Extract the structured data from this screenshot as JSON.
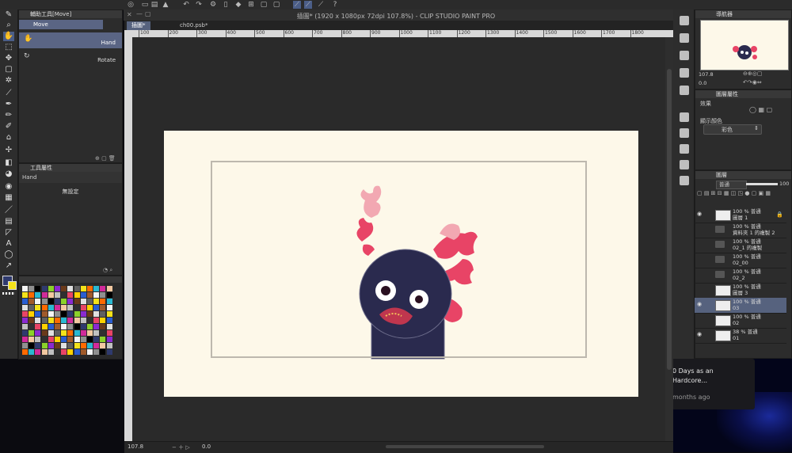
{
  "window": {
    "title": "插圖* (1920 x 1080px 72dpi 107.8%) - CLIP STUDIO PAINT PRO",
    "tabs": [
      "插圖*",
      "ch00.psb*"
    ]
  },
  "sub_tool": {
    "header": "輔助工具[Move]",
    "tab_label": "Move",
    "items": [
      {
        "label": "Hand",
        "selected": true
      },
      {
        "label": "Rotate",
        "selected": false
      }
    ]
  },
  "tool_property": {
    "header": "工具屬性",
    "tool_name": "Hand",
    "preset_label": "無設定"
  },
  "navigator": {
    "header": "導航器",
    "zoom": "107.8",
    "angle": "0.0"
  },
  "layer_property": {
    "header": "圖層屬性",
    "effect_label": "效果",
    "display_color_label": "顯示顏色",
    "color_value": "彩色"
  },
  "layer_panel": {
    "header": "圖層",
    "blend_mode": "普通",
    "opacity": "100",
    "layers": [
      {
        "line1": "100 % 普通",
        "line2": "圖層 1",
        "type": "layer",
        "visible": true,
        "locked": true
      },
      {
        "line1": "100 % 普通",
        "line2": "資料夾 1 的複製 2",
        "type": "folder",
        "visible": false
      },
      {
        "line1": "100 % 普通",
        "line2": "02_1 的複製",
        "type": "folder",
        "visible": false
      },
      {
        "line1": "100 % 普通",
        "line2": "02_00",
        "type": "folder",
        "visible": false
      },
      {
        "line1": "100 % 普通",
        "line2": "02_2",
        "type": "folder",
        "visible": false
      },
      {
        "line1": "100 % 普通",
        "line2": "圖層 3",
        "type": "layer",
        "visible": false
      },
      {
        "line1": "100 % 普通",
        "line2": "03",
        "type": "layer",
        "visible": true,
        "selected": true
      },
      {
        "line1": "100 % 普通",
        "line2": "02",
        "type": "layer",
        "visible": false
      },
      {
        "line1": "38 % 普通",
        "line2": "01",
        "type": "layer",
        "visible": true
      }
    ]
  },
  "ruler_ticks": [
    "100",
    "200",
    "300",
    "400",
    "500",
    "600",
    "700",
    "800",
    "900",
    "1000",
    "1100",
    "1200",
    "1300",
    "1400",
    "1500",
    "1600",
    "1700",
    "1800"
  ],
  "status": {
    "zoom": "107.8",
    "angle": "0.0"
  },
  "notification": {
    "line1": "0 Days as an",
    "line2": "Hardcore...",
    "line3": "months ago"
  },
  "colors": {
    "main": "#2f3a6e",
    "sub": "#f4e21a",
    "character_body": "#2a2a4e",
    "gills": "#e84466",
    "paper": "#fdf8e9"
  }
}
